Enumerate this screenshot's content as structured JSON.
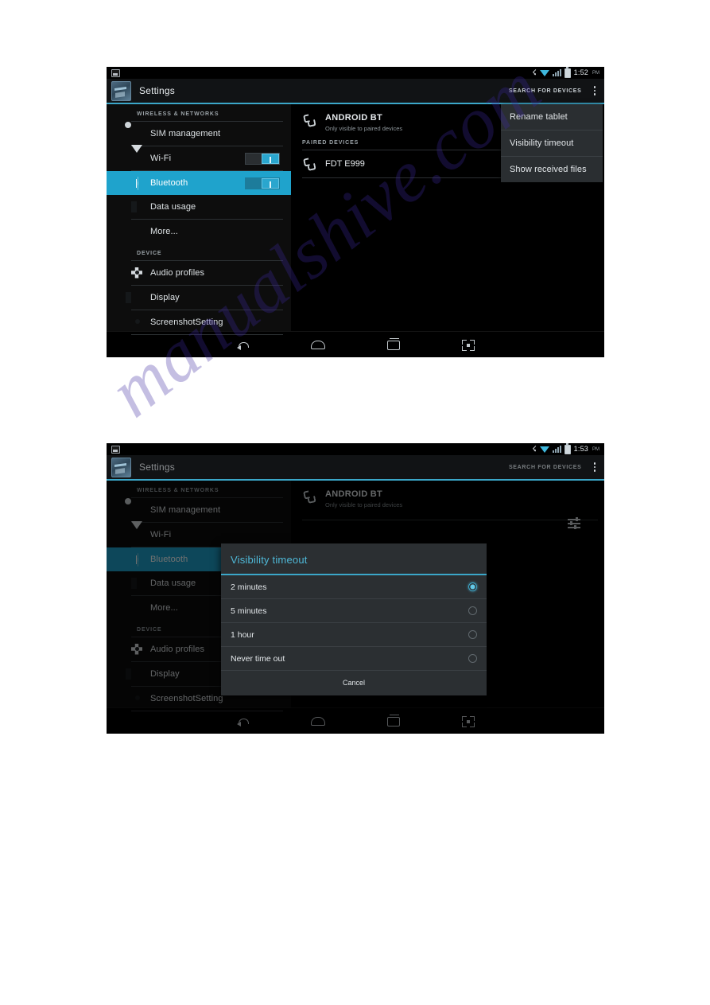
{
  "watermark": {
    "text": "manualshive.com"
  },
  "screenshot1": {
    "statusbar": {
      "screenshot_icon": "screenshot-icon",
      "bluetooth_icon": "bluetooth-icon",
      "wifi_icon": "wifi-icon",
      "signal_icon": "signal-icon",
      "battery_icon": "battery-icon",
      "time": "1:52",
      "ampm": "PM"
    },
    "actionbar": {
      "app_icon": "settings-app-icon",
      "title": "Settings",
      "search_label": "SEARCH FOR DEVICES",
      "overflow_icon": "overflow-menu-icon"
    },
    "sidebar": {
      "section1": "WIRELESS & NETWORKS",
      "section2": "DEVICE",
      "items": [
        {
          "label": "SIM management",
          "icon": "sim-card-icon",
          "toggle": null,
          "selected": false
        },
        {
          "label": "Wi-Fi",
          "icon": "wifi-icon",
          "toggle": "on",
          "selected": false
        },
        {
          "label": "Bluetooth",
          "icon": "bluetooth-icon",
          "toggle": "on",
          "selected": true
        },
        {
          "label": "Data usage",
          "icon": "data-usage-icon",
          "toggle": null,
          "selected": false
        },
        {
          "label": "More...",
          "icon": null,
          "toggle": null,
          "selected": false
        },
        {
          "label": "Audio profiles",
          "icon": "audio-profiles-icon",
          "toggle": null,
          "selected": false
        },
        {
          "label": "Display",
          "icon": "display-icon",
          "toggle": null,
          "selected": false
        },
        {
          "label": "ScreenshotSetting",
          "icon": "camera-icon",
          "toggle": null,
          "selected": false
        }
      ]
    },
    "pane": {
      "device_name": "ANDROID BT",
      "device_sub": "Only visible to paired devices",
      "paired_section": "PAIRED DEVICES",
      "paired_device": "FDT E999",
      "phone_icon": "bluetooth-phone-icon"
    },
    "popup": {
      "items": [
        "Rename tablet",
        "Visibility timeout",
        "Show received files"
      ]
    },
    "navbar": {
      "back": "back-icon",
      "home": "home-icon",
      "recents": "recents-icon",
      "screenshot": "screenshot-capture-icon"
    }
  },
  "screenshot2": {
    "statusbar": {
      "time": "1:53",
      "ampm": "PM"
    },
    "actionbar": {
      "title": "Settings",
      "search_label": "SEARCH FOR DEVICES"
    },
    "sidebar": {
      "section1": "WIRELESS & NETWORKS",
      "section2": "DEVICE",
      "items": [
        {
          "label": "SIM management",
          "icon": "sim-card-icon",
          "selected": false
        },
        {
          "label": "Wi-Fi",
          "icon": "wifi-icon",
          "selected": false
        },
        {
          "label": "Bluetooth",
          "icon": "bluetooth-icon",
          "selected": true
        },
        {
          "label": "Data usage",
          "icon": "data-usage-icon",
          "selected": false
        },
        {
          "label": "More...",
          "icon": null,
          "selected": false
        },
        {
          "label": "Audio profiles",
          "icon": "audio-profiles-icon",
          "selected": false
        },
        {
          "label": "Display",
          "icon": "display-icon",
          "selected": false
        },
        {
          "label": "ScreenshotSetting",
          "icon": "camera-icon",
          "selected": false
        }
      ]
    },
    "pane": {
      "device_name": "ANDROID BT",
      "device_sub": "Only visible to paired devices",
      "sliders_icon": "sort-settings-icon"
    },
    "dialog": {
      "title": "Visibility timeout",
      "options": [
        {
          "label": "2 minutes",
          "selected": true
        },
        {
          "label": "5 minutes",
          "selected": false
        },
        {
          "label": "1 hour",
          "selected": false
        },
        {
          "label": "Never time out",
          "selected": false
        }
      ],
      "cancel_label": "Cancel"
    }
  },
  "colors": {
    "accent": "#3ba7c9",
    "selected_row": "#1fa3cc",
    "dialog_title": "#4fb9d8",
    "popup_bg": "#2a2e31"
  }
}
